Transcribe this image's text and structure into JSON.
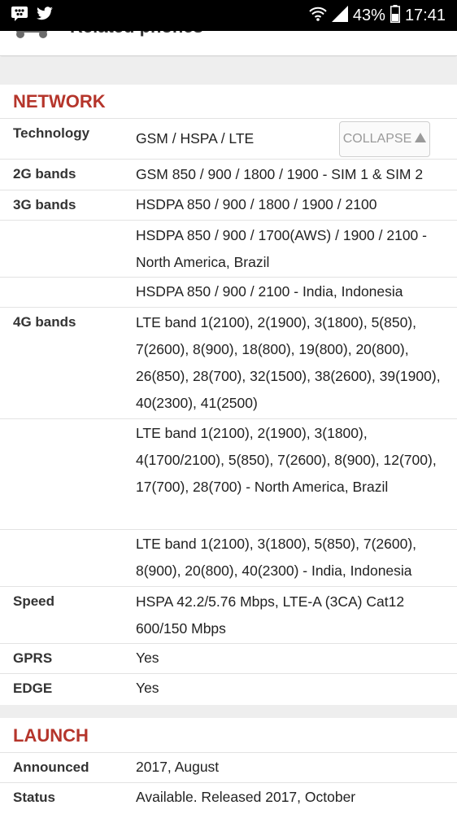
{
  "status_bar": {
    "battery": "43%",
    "time": "17:41",
    "icons": [
      "bbm-icon",
      "twitter-icon",
      "wifi-icon",
      "signal-icon",
      "battery-icon"
    ]
  },
  "top_card": {
    "label": "Related phones"
  },
  "network": {
    "title": "NETWORK",
    "collapse_label": "COLLAPSE",
    "rows": [
      {
        "label": "Technology",
        "value": "GSM / HSPA / LTE"
      },
      {
        "label": "2G bands",
        "value": "GSM 850 / 900 / 1800 / 1900 - SIM 1 & SIM 2"
      },
      {
        "label": "3G bands",
        "value": "HSDPA 850 / 900 / 1800 / 1900 / 2100"
      },
      {
        "label": "",
        "value": "HSDPA 850 / 900 / 1700(AWS) / 1900 / 2100 - North America, Brazil"
      },
      {
        "label": "",
        "value": "HSDPA 850 / 900 / 2100 - India, Indonesia"
      },
      {
        "label": "4G bands",
        "value": "LTE band 1(2100), 2(1900), 3(1800), 5(850), 7(2600), 8(900), 18(800), 19(800), 20(800), 26(850), 28(700), 32(1500), 38(2600), 39(1900), 40(2300), 41(2500)"
      },
      {
        "label": "",
        "value": "LTE band 1(2100), 2(1900), 3(1800), 4(1700/2100), 5(850), 7(2600), 8(900), 12(700), 17(700), 28(700) - North America, Brazil"
      },
      {
        "label": "",
        "value": "LTE band 1(2100), 3(1800), 5(850), 7(2600), 8(900), 20(800), 40(2300) - India, Indonesia"
      },
      {
        "label": "Speed",
        "value": "HSPA 42.2/5.76 Mbps, LTE-A (3CA) Cat12 600/150 Mbps"
      },
      {
        "label": "GPRS",
        "value": "Yes"
      },
      {
        "label": "EDGE",
        "value": "Yes"
      }
    ]
  },
  "launch": {
    "title": "LAUNCH",
    "rows": [
      {
        "label": "Announced",
        "value": "2017, August"
      },
      {
        "label": "Status",
        "value": "Available. Released 2017, October"
      }
    ]
  },
  "colors": {
    "accent": "#b5352b",
    "divider": "#e3e3e3",
    "section_gap": "#eeeeee"
  }
}
